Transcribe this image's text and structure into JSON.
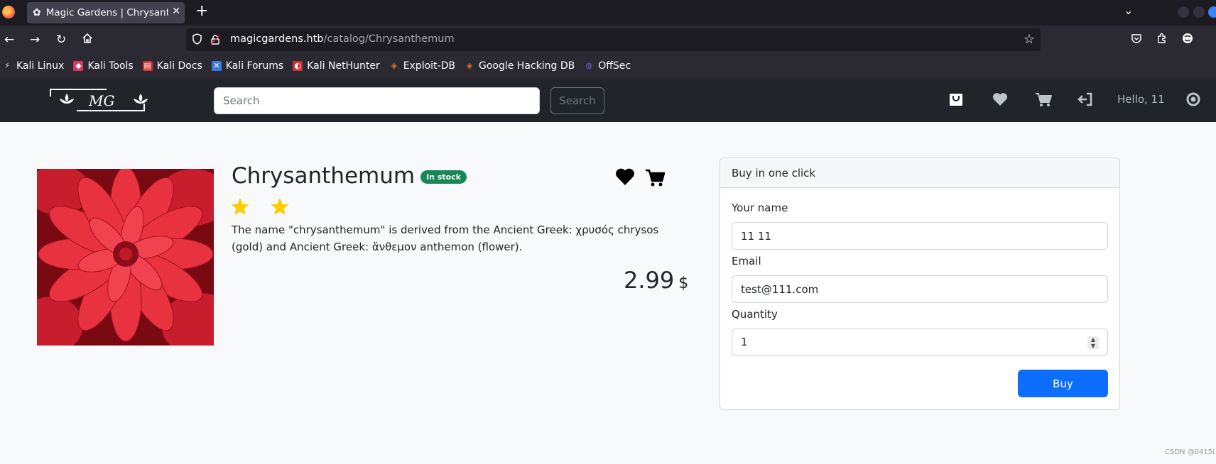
{
  "browser": {
    "tab_title": "Magic Gardens | Chrysanthemum",
    "url_host": "magicgardens.htb",
    "url_path": "/catalog/Chrysanthemum",
    "bookmarks": [
      {
        "label": "Kali Linux",
        "color": "#e8e8e8"
      },
      {
        "label": "Kali Tools",
        "color": "#e0325e"
      },
      {
        "label": "Kali Docs",
        "color": "#d32f2f"
      },
      {
        "label": "Kali Forums",
        "color": "#3c7be0"
      },
      {
        "label": "Kali NetHunter",
        "color": "#d32f2f"
      },
      {
        "label": "Exploit-DB",
        "color": "#f26c22"
      },
      {
        "label": "Google Hacking DB",
        "color": "#f26c22"
      },
      {
        "label": "OffSec",
        "color": "#6e5cd6"
      }
    ]
  },
  "header": {
    "logo_text": "MG",
    "search_placeholder": "Search",
    "search_button": "Search",
    "greeting": "Hello, 11"
  },
  "product": {
    "name": "Chrysanthemum",
    "stock_status": "In stock",
    "rating_stars": 2,
    "description": "The name \"chrysanthemum\" is derived from the Ancient Greek: χρυσός chrysos (gold) and Ancient Greek: ἄνθεμον anthemon (flower).",
    "price": "2.99",
    "currency": "$"
  },
  "buy_form": {
    "title": "Buy in one click",
    "name_label": "Your name",
    "name_value": "11 11",
    "email_label": "Email",
    "email_value": "test@111.com",
    "quantity_label": "Quantity",
    "quantity_value": "1",
    "submit_label": "Buy"
  },
  "watermark": "CSDN @0415i"
}
